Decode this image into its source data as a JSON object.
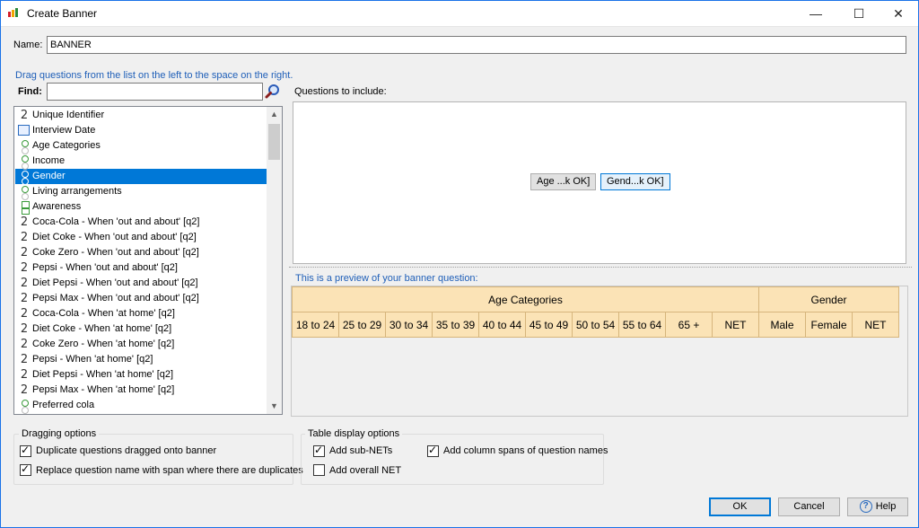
{
  "window": {
    "title": "Create Banner",
    "minimize": "—",
    "maximize": "☐",
    "close": "✕"
  },
  "name": {
    "label": "Name:",
    "value": "BANNER"
  },
  "instructions": "Drag questions from the list on the left to the space on the right.",
  "find": {
    "label": "Find:",
    "value": "",
    "icon": "magnifier-icon"
  },
  "questions": [
    {
      "label": "Unique Identifier",
      "icon": "number",
      "selected": false
    },
    {
      "label": "Interview Date",
      "icon": "date",
      "selected": false
    },
    {
      "label": "Age Categories",
      "icon": "single",
      "selected": false
    },
    {
      "label": "Income",
      "icon": "single",
      "selected": false
    },
    {
      "label": "Gender",
      "icon": "single",
      "selected": true
    },
    {
      "label": "Living arrangements",
      "icon": "single",
      "selected": false
    },
    {
      "label": "Awareness",
      "icon": "multi",
      "selected": false
    },
    {
      "label": "Coca-Cola - When 'out and about' [q2]",
      "icon": "number",
      "selected": false
    },
    {
      "label": "Diet Coke - When 'out and about' [q2]",
      "icon": "number",
      "selected": false
    },
    {
      "label": "Coke Zero - When 'out and about' [q2]",
      "icon": "number",
      "selected": false
    },
    {
      "label": "Pepsi - When 'out and about' [q2]",
      "icon": "number",
      "selected": false
    },
    {
      "label": "Diet Pepsi - When 'out and about' [q2]",
      "icon": "number",
      "selected": false
    },
    {
      "label": "Pepsi Max - When 'out and about' [q2]",
      "icon": "number",
      "selected": false
    },
    {
      "label": "Coca-Cola - When 'at home' [q2]",
      "icon": "number",
      "selected": false
    },
    {
      "label": "Diet Coke - When 'at home' [q2]",
      "icon": "number",
      "selected": false
    },
    {
      "label": "Coke Zero - When 'at home' [q2]",
      "icon": "number",
      "selected": false
    },
    {
      "label": "Pepsi - When 'at home' [q2]",
      "icon": "number",
      "selected": false
    },
    {
      "label": "Diet Pepsi - When 'at home' [q2]",
      "icon": "number",
      "selected": false
    },
    {
      "label": "Pepsi Max - When 'at home' [q2]",
      "icon": "number",
      "selected": false
    },
    {
      "label": "Preferred cola",
      "icon": "single",
      "selected": false
    }
  ],
  "include": {
    "label": "Questions to include:",
    "chips": [
      "Age ...k OK]",
      "Gend...k OK]"
    ]
  },
  "preview": {
    "label": "This is a preview of your banner question:",
    "groups": [
      {
        "name": "Age Categories",
        "columns": [
          "18 to 24",
          "25 to 29",
          "30 to 34",
          "35 to 39",
          "40 to 44",
          "45 to 49",
          "50 to 54",
          "55 to 64",
          "65 +",
          "NET"
        ]
      },
      {
        "name": "Gender",
        "columns": [
          "Male",
          "Female",
          "NET"
        ]
      }
    ]
  },
  "dragging_options": {
    "title": "Dragging options",
    "items": [
      {
        "label": "Duplicate questions dragged onto banner",
        "checked": true
      },
      {
        "label": "Replace question name with span where there are duplicates",
        "checked": true
      }
    ]
  },
  "table_display_options": {
    "title": "Table display options",
    "add_sub_nets": {
      "label": "Add sub-NETs",
      "checked": true
    },
    "add_overall_net": {
      "label": "Add overall NET",
      "checked": false
    },
    "add_column_spans": {
      "label": "Add column spans of question names",
      "checked": true
    }
  },
  "buttons": {
    "ok": "OK",
    "cancel": "Cancel",
    "help": "Help"
  }
}
